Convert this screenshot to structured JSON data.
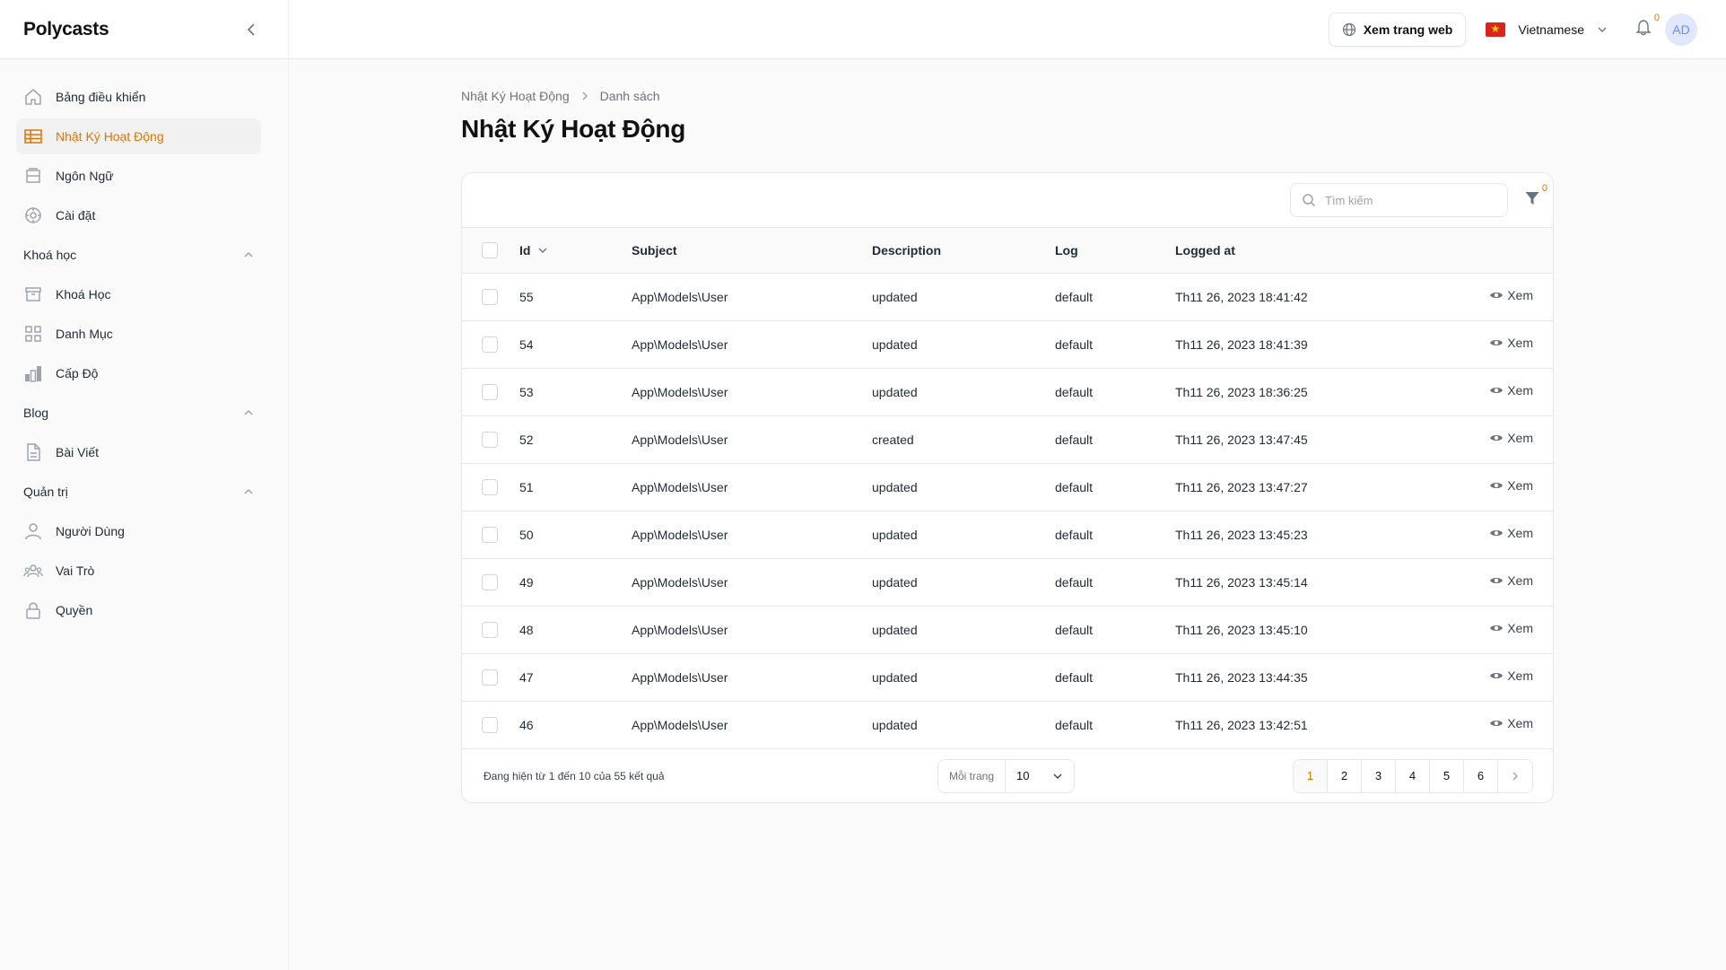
{
  "brand": "Polycasts",
  "sidebar": {
    "items": [
      {
        "label": "Bảng điều khiển",
        "icon": "home-icon"
      },
      {
        "label": "Nhật Ký Hoạt Động",
        "icon": "table-icon",
        "active": true
      },
      {
        "label": "Ngôn Ngữ",
        "icon": "inbox-icon"
      },
      {
        "label": "Cài đặt",
        "icon": "gear-icon"
      }
    ],
    "groups": [
      {
        "label": "Khoá học",
        "items": [
          {
            "label": "Khoá Học",
            "icon": "archive-icon"
          },
          {
            "label": "Danh Mục",
            "icon": "grid-icon"
          },
          {
            "label": "Cấp Độ",
            "icon": "bar-chart-icon"
          }
        ]
      },
      {
        "label": "Blog",
        "items": [
          {
            "label": "Bài Viết",
            "icon": "document-icon"
          }
        ]
      },
      {
        "label": "Quản trị",
        "items": [
          {
            "label": "Người Dùng",
            "icon": "user-icon"
          },
          {
            "label": "Vai Trò",
            "icon": "users-icon"
          },
          {
            "label": "Quyền",
            "icon": "lock-icon"
          }
        ]
      }
    ]
  },
  "topbar": {
    "view_site": "Xem trang web",
    "language": "Vietnamese",
    "notifications_count": "0",
    "avatar_initials": "AD"
  },
  "breadcrumb": {
    "parent": "Nhật Ký Hoạt Động",
    "current": "Danh sách"
  },
  "page_title": "Nhật Ký Hoạt Động",
  "search": {
    "placeholder": "Tìm kiếm"
  },
  "filter_count": "0",
  "table": {
    "columns": {
      "id": "Id",
      "subject": "Subject",
      "description": "Description",
      "log": "Log",
      "logged_at": "Logged at"
    },
    "view_label": "Xem",
    "rows": [
      {
        "id": "55",
        "subject": "App\\Models\\User",
        "description": "updated",
        "log": "default",
        "logged_at": "Th11 26, 2023 18:41:42"
      },
      {
        "id": "54",
        "subject": "App\\Models\\User",
        "description": "updated",
        "log": "default",
        "logged_at": "Th11 26, 2023 18:41:39"
      },
      {
        "id": "53",
        "subject": "App\\Models\\User",
        "description": "updated",
        "log": "default",
        "logged_at": "Th11 26, 2023 18:36:25"
      },
      {
        "id": "52",
        "subject": "App\\Models\\User",
        "description": "created",
        "log": "default",
        "logged_at": "Th11 26, 2023 13:47:45"
      },
      {
        "id": "51",
        "subject": "App\\Models\\User",
        "description": "updated",
        "log": "default",
        "logged_at": "Th11 26, 2023 13:47:27"
      },
      {
        "id": "50",
        "subject": "App\\Models\\User",
        "description": "updated",
        "log": "default",
        "logged_at": "Th11 26, 2023 13:45:23"
      },
      {
        "id": "49",
        "subject": "App\\Models\\User",
        "description": "updated",
        "log": "default",
        "logged_at": "Th11 26, 2023 13:45:14"
      },
      {
        "id": "48",
        "subject": "App\\Models\\User",
        "description": "updated",
        "log": "default",
        "logged_at": "Th11 26, 2023 13:45:10"
      },
      {
        "id": "47",
        "subject": "App\\Models\\User",
        "description": "updated",
        "log": "default",
        "logged_at": "Th11 26, 2023 13:44:35"
      },
      {
        "id": "46",
        "subject": "App\\Models\\User",
        "description": "updated",
        "log": "default",
        "logged_at": "Th11 26, 2023 13:42:51"
      }
    ]
  },
  "footer": {
    "summary": "Đang hiện từ 1 đến 10 của 55 kết quả",
    "per_page_label": "Mỗi trang",
    "per_page_value": "10",
    "pages": [
      "1",
      "2",
      "3",
      "4",
      "5",
      "6"
    ],
    "active_page": "1"
  },
  "colors": {
    "accent": "#d97706",
    "border": "#e5e7eb",
    "avatar_bg": "#e0e7ff"
  }
}
